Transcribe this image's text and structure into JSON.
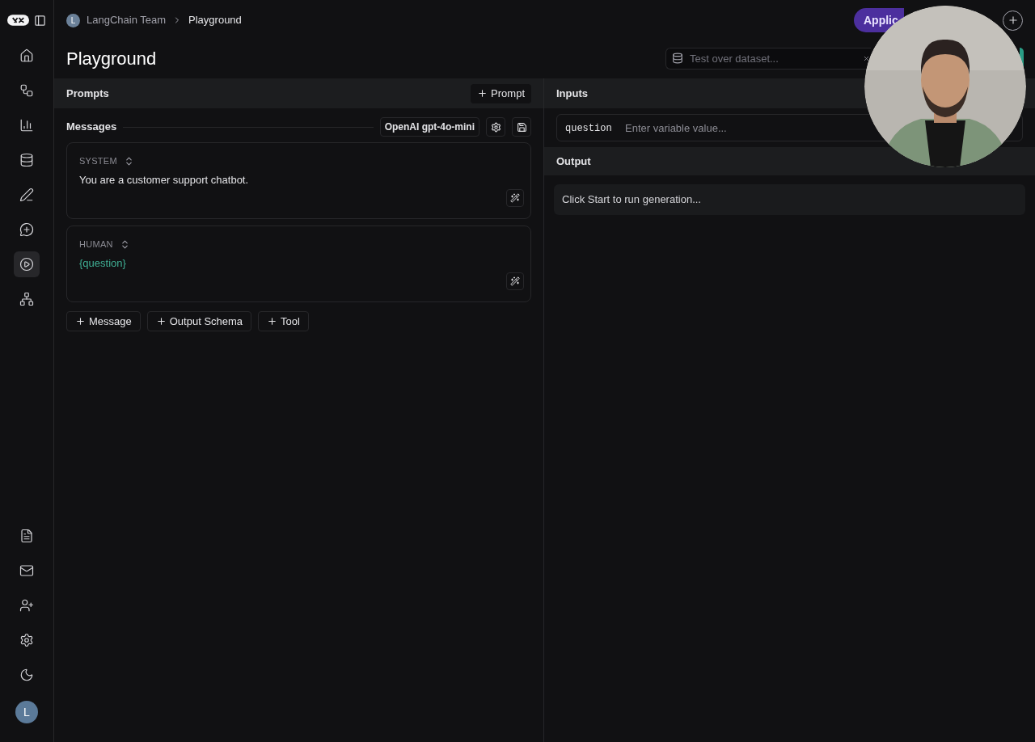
{
  "sidebar": {
    "nav": [
      {
        "kind": "home",
        "selected": false
      },
      {
        "kind": "flow",
        "selected": false
      },
      {
        "kind": "chart",
        "selected": false
      },
      {
        "kind": "database",
        "selected": false
      },
      {
        "kind": "pen",
        "selected": false
      },
      {
        "kind": "chat",
        "selected": false
      },
      {
        "kind": "play",
        "selected": true
      },
      {
        "kind": "network",
        "selected": false
      }
    ],
    "bottom": [
      {
        "kind": "docs"
      },
      {
        "kind": "mail"
      },
      {
        "kind": "invite"
      },
      {
        "kind": "settings"
      },
      {
        "kind": "theme"
      }
    ],
    "avatar": "L"
  },
  "breadcrumb": {
    "avatar": "L",
    "items": [
      "LangChain Team",
      "Playground"
    ]
  },
  "page_title": "Playground",
  "header": {
    "app_button": "Applic",
    "dataset": {
      "placeholder": "Test over dataset..."
    }
  },
  "prompts": {
    "title": "Prompts",
    "add_button": "Prompt",
    "messages_label": "Messages",
    "model": "OpenAI gpt-4o-mini",
    "messages": [
      {
        "role": "SYSTEM",
        "text": "You are a customer support chatbot.",
        "kind": "plain"
      },
      {
        "role": "HUMAN",
        "text": "{question}",
        "kind": "variable"
      }
    ],
    "actions": [
      "Message",
      "Output Schema",
      "Tool"
    ]
  },
  "inputs": {
    "title": "Inputs",
    "variables": [
      {
        "name": "question",
        "placeholder": "Enter variable value..."
      }
    ]
  },
  "output": {
    "title": "Output",
    "placeholder": "Click Start to run generation..."
  }
}
